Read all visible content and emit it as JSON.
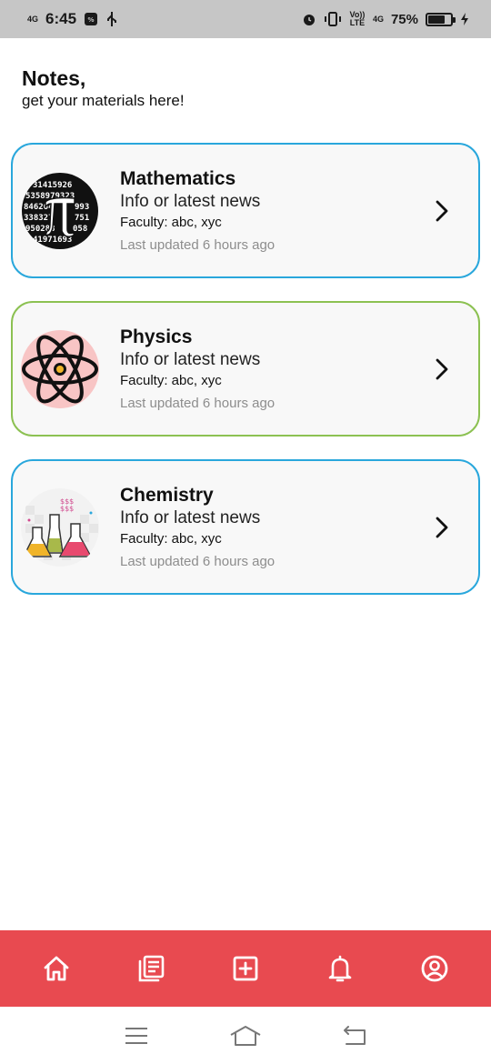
{
  "status_bar": {
    "network": "4G",
    "time": "6:45",
    "volte": "Vo)) LTE",
    "signal_type": "4G",
    "battery": "75%",
    "battery_level": 0.75,
    "icons": [
      "alarm-icon",
      "vibrate-icon",
      "usb-icon",
      "charging-icon"
    ]
  },
  "header": {
    "title": "Notes,",
    "subtitle": "get your materials here!"
  },
  "subjects": [
    {
      "title": "Mathematics",
      "info": "Info or latest news",
      "faculty": "Faculty:  abc, xyc",
      "updated": "Last updated 6 hours ago",
      "icon": "pi-icon",
      "border_color": "#29a7dc"
    },
    {
      "title": "Physics",
      "info": "Info or latest news",
      "faculty": "Faculty:  abc, xyc",
      "updated": "Last updated 6 hours ago",
      "icon": "atom-icon",
      "border_color": "#8cc152"
    },
    {
      "title": "Chemistry",
      "info": "Info or latest news",
      "faculty": "Faculty:  abc, xyc",
      "updated": "Last updated 6 hours ago",
      "icon": "flasks-icon",
      "border_color": "#29a7dc"
    }
  ],
  "bottom_nav": {
    "background": "#e84a50",
    "items": [
      "home-icon",
      "notes-icon",
      "add-icon",
      "bell-icon",
      "profile-icon"
    ]
  },
  "system_nav": {
    "items": [
      "menu-icon",
      "home-outline-icon",
      "back-icon"
    ]
  }
}
